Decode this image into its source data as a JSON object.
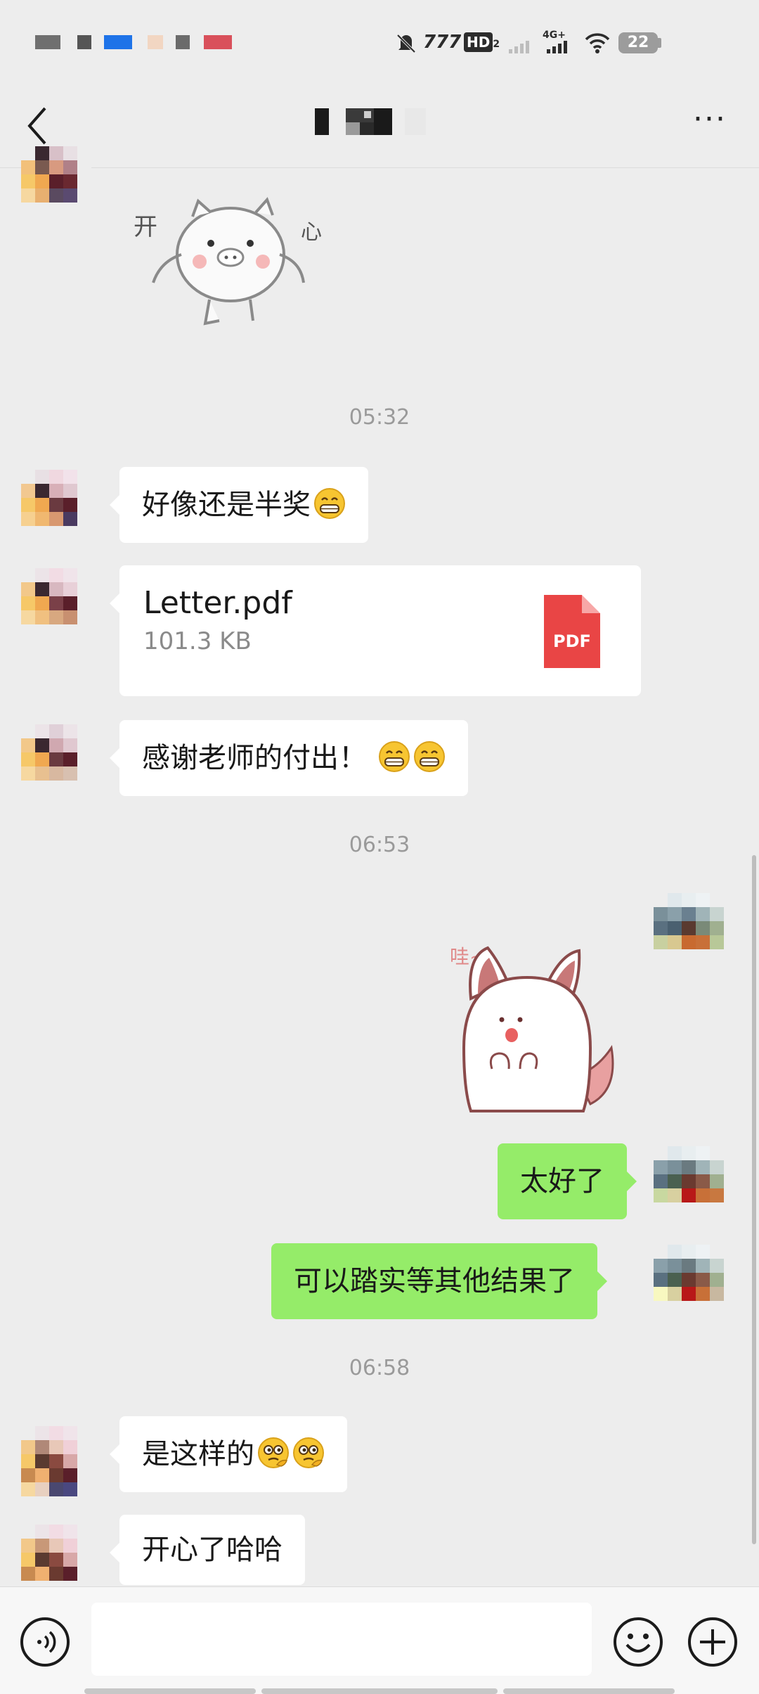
{
  "status_bar": {
    "battery": "22",
    "icons": [
      "mute-icon",
      "carrier-signal-icon",
      "hd-icon",
      "signal-weak-icon",
      "4g-signal-icon",
      "wifi-icon",
      "battery-icon"
    ]
  },
  "header": {
    "title": "",
    "more_label": "···"
  },
  "messages": {
    "ts1": "05:32",
    "m1": "好像还是半奖",
    "file": {
      "name": "Letter.pdf",
      "size": "101.3 KB",
      "type_label": "PDF"
    },
    "m2": "感谢老师的付出！",
    "ts2": "06:53",
    "m3": "太好了",
    "m4": "可以踏实等其他结果了",
    "ts3": "06:58",
    "m5": "是这样的",
    "m6": "开心了哈哈"
  },
  "stickers": {
    "pig_text": "开心",
    "cat_text": "哇~"
  },
  "input": {
    "value": "",
    "placeholder": ""
  },
  "colors": {
    "background": "#ededed",
    "my_bubble": "#95ec69",
    "their_bubble": "#ffffff",
    "pdf": "#e94545"
  }
}
